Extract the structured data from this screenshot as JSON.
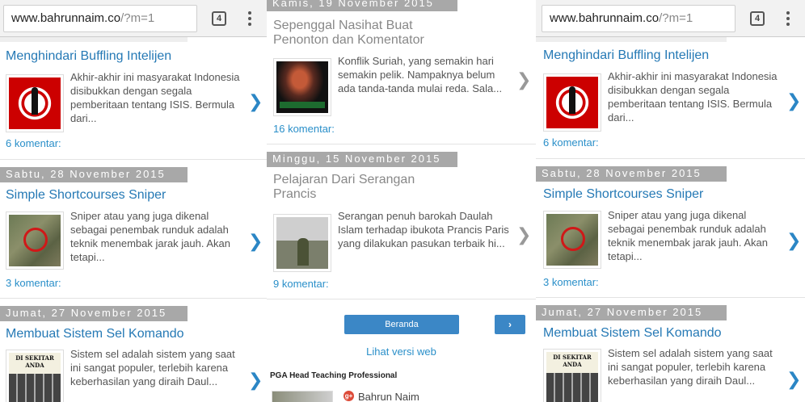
{
  "browser": {
    "url_host": "www.bahrunnaim.co",
    "url_path": "/?m=1",
    "tab_count": "4"
  },
  "colors": {
    "link_blue": "#2579b5",
    "date_bar": "#a8a8a8",
    "button_blue": "#3b87c6"
  },
  "posts": {
    "intel": {
      "title": "Menghindari Buffling Intelijen",
      "snippet": "Akhir-akhir ini masyarakat Indonesia disibukkan dengan segala pemberitaan tentang ISIS. Bermula dari...",
      "comments": "6 komentar:",
      "thumb_icon": "spy-silhouette-thumbnail"
    },
    "sniper": {
      "date": "Sabtu, 28 November 2015",
      "title": "Simple Shortcourses Sniper",
      "snippet": "Sniper atau yang juga dikenal sebagai penembak runduk adalah teknik menembak jarak jauh. Akan tetapi...",
      "comments": "3 komentar:",
      "thumb_icon": "sniper-camouflage-thumbnail"
    },
    "cell": {
      "date": "Jumat, 27 November 2015",
      "title": "Membuat Sistem Sel Komando",
      "snippet": "Sistem sel adalah sistem yang saat ini sangat populer, terlebih karena keberhasilan yang diraih Daul...",
      "thumb_icon": "cell-system-poster-thumbnail"
    },
    "nasihat": {
      "date": "Kamis, 19 November 2015",
      "title": "Sepenggal Nasihat Buat Penonton dan Komentator",
      "snippet": "Konflik Suriah, yang semakin hari semakin pelik. Nampaknya belum ada tanda-tanda mulai reda. Sala...",
      "comments": "16 komentar:",
      "thumb_icon": "syria-conflict-thumbnail"
    },
    "paris": {
      "date": "Minggu, 15 November 2015",
      "title": "Pelajaran Dari Serangan Prancis",
      "snippet": "Serangan penuh barokah Daulah Islam terhadap ibukota Prancis Paris yang dilakukan pasukan terbaik hi...",
      "comments": "9 komentar:",
      "thumb_icon": "paris-soldier-thumbnail"
    }
  },
  "nav": {
    "home_label": "Beranda",
    "next_label": "›",
    "web_version": "Lihat versi web"
  },
  "profile": {
    "title": "PGA Head Teaching Professional",
    "gplus_label": "g+",
    "author": "Bahrun Naim"
  }
}
